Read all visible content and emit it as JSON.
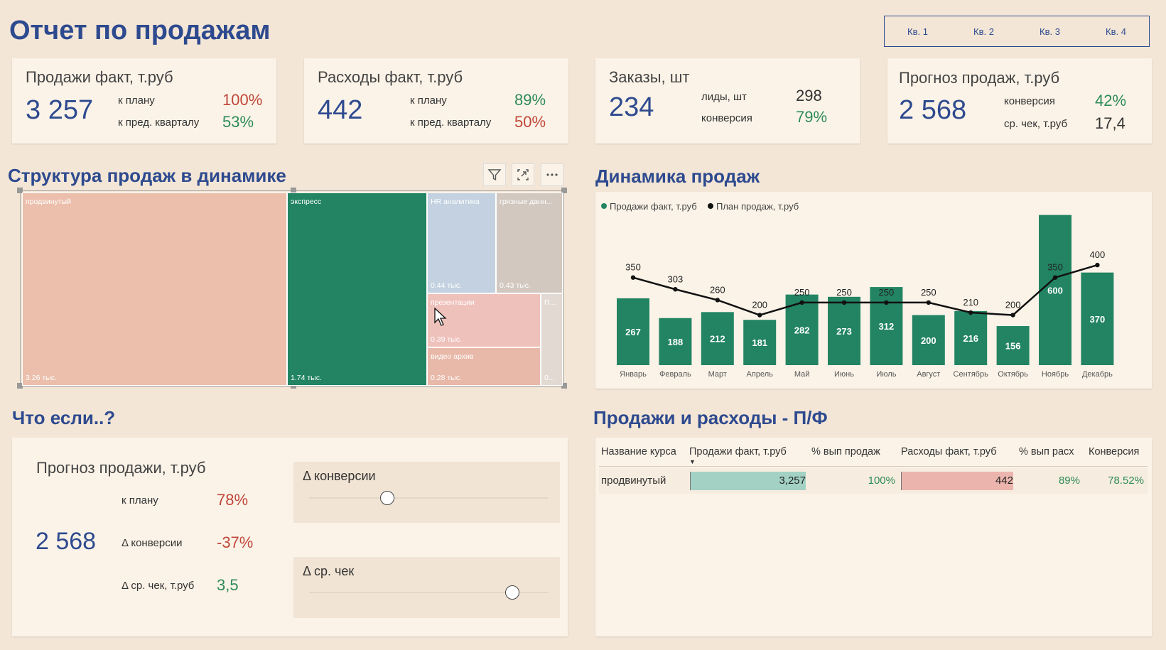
{
  "title": "Отчет по продажам",
  "quarters": [
    "Кв. 1",
    "Кв. 2",
    "Кв. 3",
    "Кв. 4"
  ],
  "kpis": {
    "sales": {
      "title": "Продажи факт, т.руб",
      "value": "3 257",
      "r1_label": "к плану",
      "r1_value": "100%",
      "r2_label": "к пред. кварталу",
      "r2_value": "53%"
    },
    "costs": {
      "title": "Расходы факт, т.руб",
      "value": "442",
      "r1_label": "к плану",
      "r1_value": "89%",
      "r2_label": "к пред. кварталу",
      "r2_value": "50%"
    },
    "orders": {
      "title": "Заказы, шт",
      "value": "234",
      "r1_label": "лиды, шт",
      "r1_value": "298",
      "r2_label": "конверсия",
      "r2_value": "79%"
    },
    "forecast": {
      "title": "Прогноз продаж, т.руб",
      "value": "2 568",
      "r1_label": "конверсия",
      "r1_value": "42%",
      "r2_label": "ср. чек, т.руб",
      "r2_value": "17,4"
    }
  },
  "structure": {
    "title": "Структура продаж в динамике",
    "tiles": [
      {
        "name": "продвинутый",
        "value": "3.26 тыс."
      },
      {
        "name": "экспресс",
        "value": "1.74 тыс."
      },
      {
        "name": "HR аналитика",
        "value": "0.44 тыс."
      },
      {
        "name": "грязные данн...",
        "value": "0.43 тыс."
      },
      {
        "name": "презентации",
        "value": "0.39 тыс."
      },
      {
        "name": "видео архив",
        "value": "0.28 тыс."
      },
      {
        "name": "П...",
        "value": "0..."
      }
    ],
    "icons": [
      "filter-icon",
      "focus-mode-icon",
      "more-options-icon"
    ]
  },
  "dynamics": {
    "title": "Динамика продаж",
    "legend": [
      "Продажи факт, т.руб",
      "План продаж, т.руб"
    ]
  },
  "chart_data": {
    "type": "bar",
    "categories": [
      "Январь",
      "Февраль",
      "Март",
      "Апрель",
      "Май",
      "Июнь",
      "Июль",
      "Август",
      "Сентябрь",
      "Октябрь",
      "Ноябрь",
      "Декабрь"
    ],
    "series": [
      {
        "name": "Продажи факт, т.руб",
        "type": "bar",
        "values": [
          267,
          188,
          212,
          181,
          282,
          273,
          312,
          200,
          216,
          156,
          600,
          370
        ]
      },
      {
        "name": "План продаж, т.руб",
        "type": "line",
        "values": [
          350,
          303,
          260,
          200,
          250,
          250,
          250,
          250,
          210,
          200,
          350,
          400
        ]
      }
    ],
    "ylim": [
      0,
      650
    ],
    "grid": false,
    "legend_position": "top-left",
    "colors": {
      "bars": "#228462",
      "line": "#111111"
    }
  },
  "whatif": {
    "title": "Что если..?",
    "card_title": "Прогноз продажи, т.руб",
    "big_value": "2 568",
    "rows": [
      {
        "label": "к плану",
        "value": "78%"
      },
      {
        "label": "Δ конверсии",
        "value": "-37%"
      },
      {
        "label": "Δ ср. чек, т.руб",
        "value": "3,5"
      }
    ],
    "slider1": {
      "label": "Δ конверсии",
      "level": 0.33
    },
    "slider2": {
      "label": "Δ ср. чек",
      "level": 0.85
    }
  },
  "table": {
    "title": "Продажи и расходы - П/Ф",
    "headers": [
      "Название курса",
      "Продажи факт, т.руб",
      "% вып продаж",
      "Расходы факт, т.руб",
      "% вып расх",
      "Конверсия"
    ],
    "row": {
      "name": "продвинутый",
      "sales": "3,257",
      "sales_pct": "100%",
      "costs": "442",
      "costs_pct": "89%",
      "conv": "78.52%"
    },
    "sales_bar_fill": 1.0,
    "costs_bar_fill": 1.0
  },
  "colors": {
    "accent": "#2e4a8f",
    "background": "#f3e6d6",
    "card": "#fbf3e8",
    "green": "#2e8b57",
    "red": "#c0473a",
    "tm_advanced": "#ebbfac",
    "tm_express": "#228462",
    "tm_hr": "#c3d1e0",
    "tm_dirty": "#d2c8c0",
    "tm_pres": "#efc1bb",
    "tm_video": "#e8b8a8",
    "tm_other": "#e2d9d2"
  }
}
